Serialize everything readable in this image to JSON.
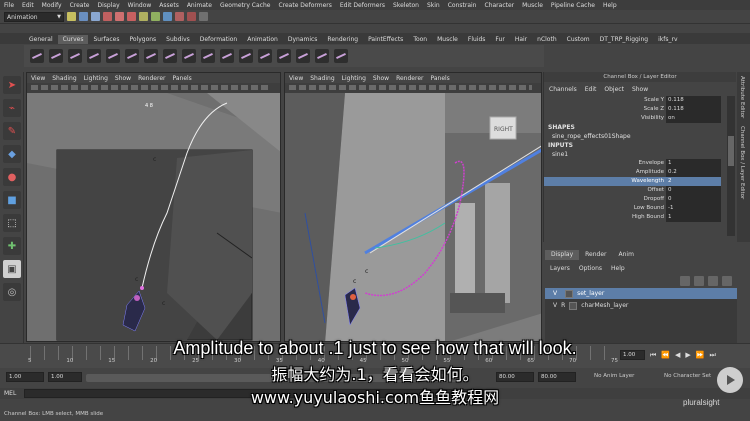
{
  "menubar": [
    "File",
    "Edit",
    "Modify",
    "Create",
    "Display",
    "Window",
    "Assets",
    "Animate",
    "Geometry Cache",
    "Create Deformers",
    "Edit Deformers",
    "Skeleton",
    "Skin",
    "Constrain",
    "Character",
    "Muscle",
    "Pipeline Cache",
    "Help"
  ],
  "status": {
    "mode": "Animation"
  },
  "shelf_tabs": [
    "General",
    "Curves",
    "Surfaces",
    "Polygons",
    "Subdivs",
    "Deformation",
    "Animation",
    "Dynamics",
    "Rendering",
    "PaintEffects",
    "Toon",
    "Muscle",
    "Fluids",
    "Fur",
    "Hair",
    "nCloth",
    "Custom",
    "DT_TRP_Rigging",
    "ikfs_rv"
  ],
  "shelf_active": "Curves",
  "viewport_menu": [
    "View",
    "Shading",
    "Lighting",
    "Show",
    "Renderer",
    "Panels"
  ],
  "channel_box": {
    "title": "Channel Box / Layer Editor",
    "menu": [
      "Channels",
      "Edit",
      "Object",
      "Show"
    ],
    "top_rows": [
      {
        "label": "Scale Y",
        "value": "0.118"
      },
      {
        "label": "Scale Z",
        "value": "0.118"
      },
      {
        "label": "Visibility",
        "value": "on"
      }
    ],
    "shapes_header": "SHAPES",
    "shape_name": "sine_rope_effects01Shape",
    "inputs_header": "INPUTS",
    "input_name": "sine1",
    "input_rows": [
      {
        "label": "Envelope",
        "value": "1"
      },
      {
        "label": "Amplitude",
        "value": "0.2"
      },
      {
        "label": "Wavelength",
        "value": "2"
      },
      {
        "label": "Offset",
        "value": "0"
      },
      {
        "label": "Dropoff",
        "value": "0"
      },
      {
        "label": "Low Bound",
        "value": "-1"
      },
      {
        "label": "High Bound",
        "value": "1"
      }
    ],
    "selected_row": "Wavelength"
  },
  "side_tabs": [
    "Attribute Editor",
    "Channel Box / Layer Editor"
  ],
  "layer_editor": {
    "tabs": [
      "Display",
      "Render",
      "Anim"
    ],
    "menu": [
      "Layers",
      "Options",
      "Help"
    ],
    "layers": [
      {
        "v": "V",
        "r": "",
        "name": "set_layer",
        "selected": true
      },
      {
        "v": "V",
        "r": "R",
        "name": "charMesh_layer",
        "selected": false
      }
    ]
  },
  "timeline": {
    "ticks": [
      "5",
      "10",
      "15",
      "20",
      "25",
      "30",
      "35",
      "40",
      "45",
      "50",
      "55",
      "60",
      "65",
      "70",
      "75"
    ],
    "current_frame": "1.00"
  },
  "range": {
    "start": "1.00",
    "range_start": "1.00",
    "range_end": "80.00",
    "end": "80.00",
    "anim_layer": "No Anim Layer",
    "character": "No Character Set"
  },
  "command_line": {
    "label": "MEL"
  },
  "help_line": "Channel Box: LMB select, MMB slide",
  "watermark": "pluralsight",
  "subtitles": {
    "english": "Amplitude to about .1 just to see how that will look.",
    "chinese": "振幅大约为.1，看看会如何。",
    "site": "www.yuyulaoshi.com鱼鱼教程网"
  },
  "icons": [
    "select-tool-icon",
    "lasso-icon",
    "paint-icon",
    "move-icon",
    "rotate-icon",
    "scale-icon",
    "layout-icon"
  ]
}
